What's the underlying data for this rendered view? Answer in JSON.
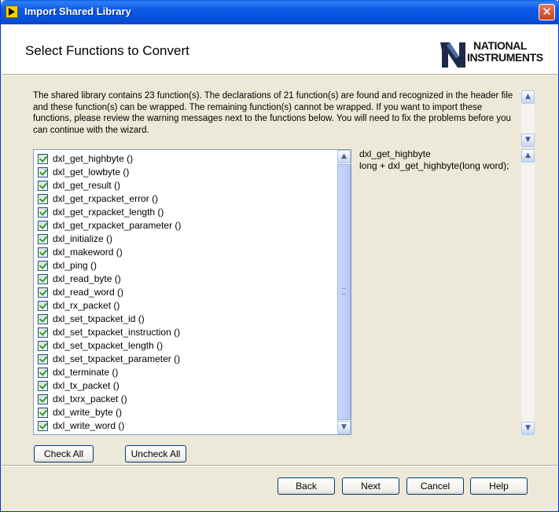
{
  "window": {
    "title": "Import Shared Library"
  },
  "header": {
    "heading": "Select Functions to Convert",
    "logo_line1": "NATIONAL",
    "logo_line2": "INSTRUMENTS"
  },
  "description": "The shared library contains 23 function(s). The declarations of 21 function(s) are found and recognized in the header file and these function(s) can be wrapped. The remaining function(s) cannot be wrapped. If you want to import these functions, please review the warning messages next to the functions below. You will need to fix the problems before you can continue with the wizard.",
  "functions": [
    {
      "label": "dxl_get_highbyte ()",
      "checked": true
    },
    {
      "label": "dxl_get_lowbyte ()",
      "checked": true
    },
    {
      "label": "dxl_get_result ()",
      "checked": true
    },
    {
      "label": "dxl_get_rxpacket_error ()",
      "checked": true
    },
    {
      "label": "dxl_get_rxpacket_length ()",
      "checked": true
    },
    {
      "label": "dxl_get_rxpacket_parameter ()",
      "checked": true
    },
    {
      "label": "dxl_initialize ()",
      "checked": true
    },
    {
      "label": "dxl_makeword ()",
      "checked": true
    },
    {
      "label": "dxl_ping ()",
      "checked": true
    },
    {
      "label": "dxl_read_byte ()",
      "checked": true
    },
    {
      "label": "dxl_read_word ()",
      "checked": true
    },
    {
      "label": "dxl_rx_packet ()",
      "checked": true
    },
    {
      "label": "dxl_set_txpacket_id ()",
      "checked": true
    },
    {
      "label": "dxl_set_txpacket_instruction ()",
      "checked": true
    },
    {
      "label": "dxl_set_txpacket_length ()",
      "checked": true
    },
    {
      "label": "dxl_set_txpacket_parameter ()",
      "checked": true
    },
    {
      "label": "dxl_terminate ()",
      "checked": true
    },
    {
      "label": "dxl_tx_packet ()",
      "checked": true
    },
    {
      "label": "dxl_txrx_packet ()",
      "checked": true
    },
    {
      "label": "dxl_write_byte ()",
      "checked": true
    },
    {
      "label": "dxl_write_word ()",
      "checked": true
    }
  ],
  "detail": {
    "name": "dxl_get_highbyte",
    "signature": "long + dxl_get_highbyte(long word);"
  },
  "buttons": {
    "check_all": "Check All",
    "uncheck_all": "Uncheck All",
    "back": "Back",
    "next": "Next",
    "cancel": "Cancel",
    "help": "Help"
  }
}
